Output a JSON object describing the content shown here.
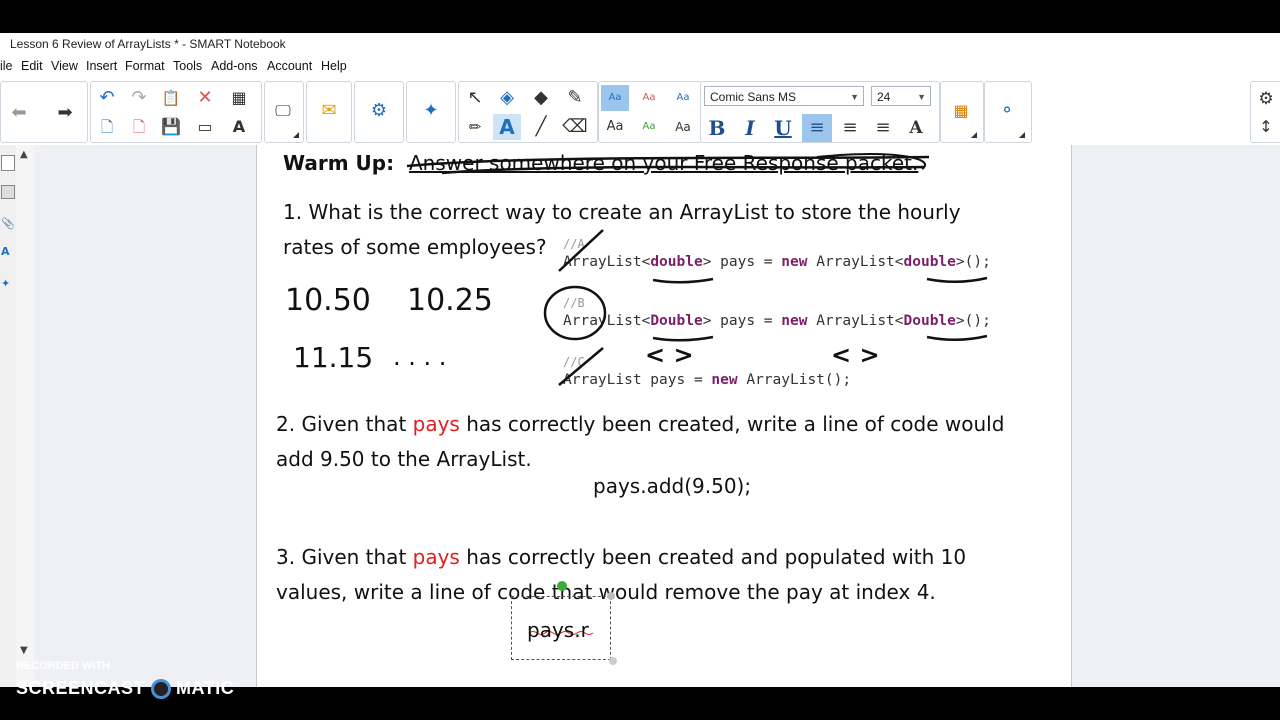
{
  "window": {
    "title": "Lesson 6 Review of ArrayLists * - SMART Notebook",
    "minimize": "—",
    "maximize": "❐",
    "close": "✕"
  },
  "menu": [
    "ile",
    "Edit",
    "View",
    "Insert",
    "Format",
    "Tools",
    "Add-ons",
    "Account",
    "Help"
  ],
  "toolbar": {
    "font_name": "Comic Sans MS",
    "font_size": "24",
    "style_top": "Aa",
    "style_bottom": "Aa",
    "bold": "B",
    "italic": "I",
    "underline": "U",
    "text_tool": "A",
    "text_fit": "A"
  },
  "slide": {
    "warmup_label": "Warm Up:",
    "warmup_struck": "Answer somewhere on your Free Response packet.",
    "q1_line1": "1.  What is the correct way to create an ArrayList to store the hourly",
    "q1_line2": "rates of some employees?",
    "codeA_comment": "//A",
    "codeB_comment": "//B",
    "codeC_comment": "//C",
    "codeA": [
      "ArrayList<",
      "double",
      "> pays = ",
      "new",
      " ArrayList<",
      "double",
      ">();"
    ],
    "codeB": [
      "ArrayList<",
      "Double",
      "> pays = ",
      "new",
      " ArrayList<",
      "Double",
      ">();"
    ],
    "codeC": [
      "ArrayList pays = ",
      "new",
      " ArrayList();"
    ],
    "handwritten": {
      "n1": "10.50",
      "n2": "10.25",
      "n3": "11.15",
      "n4": ". . . .",
      "brackets1": "< >",
      "brackets2": "< >"
    },
    "q2_pre": "2.  Given that ",
    "q2_red": "pays",
    "q2_post": " has correctly been created, write a line of code would",
    "q2_line2": "add 9.50 to the ArrayList.",
    "answer2": "pays.add(9.50);",
    "q3_pre": "3.  Given that ",
    "q3_red": "pays",
    "q3_post": " has correctly been created and populated with 10",
    "q3_line2": "values, write a line of code that would remove the pay at index 4.",
    "answer3": "pays.r"
  },
  "watermark": {
    "line1": "RECORDED WITH",
    "line2a": "SCREENCAST",
    "line2b": "MATIC"
  },
  "colors": {
    "accent_red": "#e02020",
    "keyword": "#7b1f6a",
    "toolbar_blue": "#1f6fbf"
  }
}
